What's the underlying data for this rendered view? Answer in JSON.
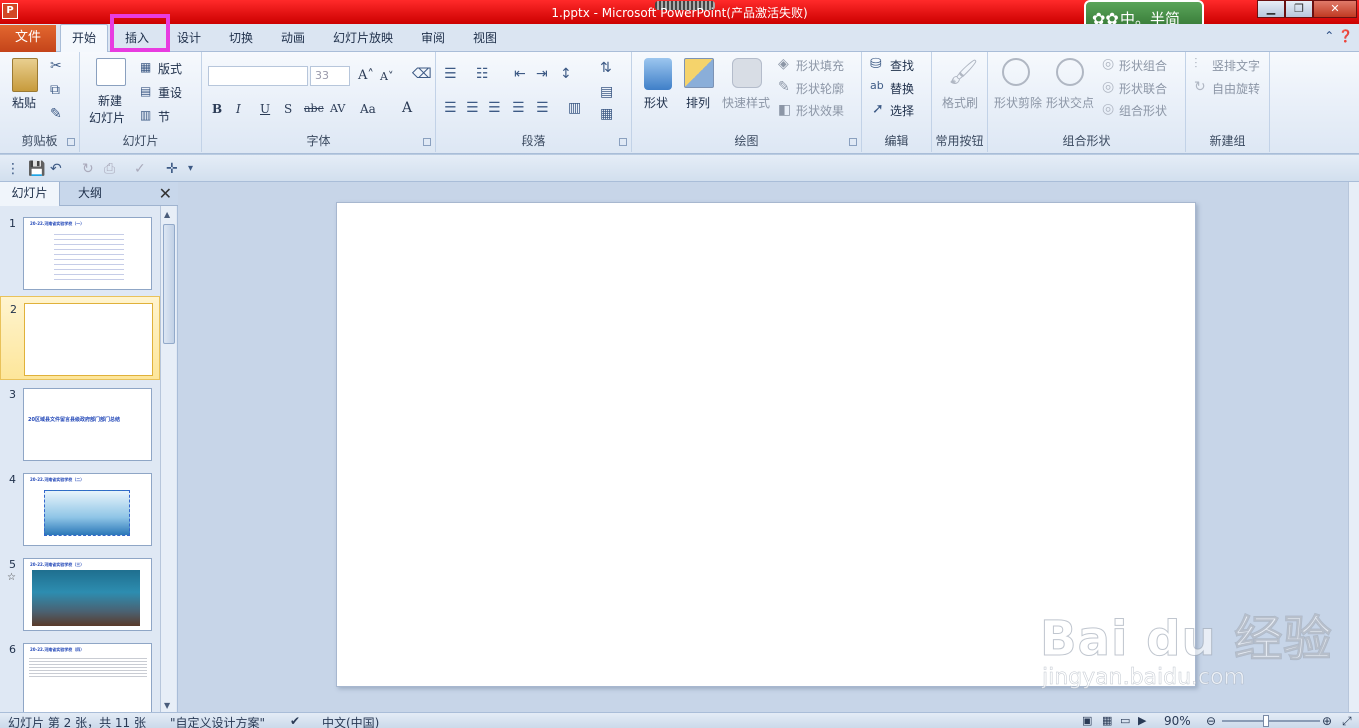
{
  "window": {
    "title": "1.pptx - Microsoft PowerPoint(产品激活失败)",
    "ime_text": "中。半简"
  },
  "tabs": {
    "file": "文件",
    "home": "开始",
    "insert": "插入",
    "design": "设计",
    "transitions": "切换",
    "animations": "动画",
    "slideshow": "幻灯片放映",
    "review": "审阅",
    "view": "视图"
  },
  "ribbon": {
    "clipboard": {
      "paste": "粘贴",
      "label": "剪贴板"
    },
    "slides": {
      "new_slide_line1": "新建",
      "new_slide_line2": "幻灯片",
      "layout": "版式",
      "reset": "重设",
      "section": "节",
      "label": "幻灯片"
    },
    "font": {
      "size_value": "33",
      "bold": "B",
      "italic": "I",
      "underline": "U",
      "shadow": "S",
      "strike": "abc",
      "spacing": "AV",
      "case": "Aa",
      "color": "A",
      "label": "字体"
    },
    "paragraph": {
      "label": "段落"
    },
    "drawing": {
      "shapes": "形状",
      "arrange": "排列",
      "quick_styles": "快速样式",
      "shape_fill": "形状填充",
      "shape_outline": "形状轮廓",
      "shape_effects": "形状效果",
      "label": "绘图"
    },
    "editing": {
      "find": "查找",
      "replace": "替换",
      "select": "选择",
      "label": "编辑"
    },
    "common": {
      "format_painter": "格式刷",
      "label": "常用按钮"
    },
    "combine": {
      "shape_subtract": "形状剪除",
      "shape_intersect": "形状交点",
      "shape_combine": "形状组合",
      "shape_union": "形状联合",
      "combine_shapes": "组合形状",
      "label": "组合形状"
    },
    "newgroup": {
      "vertical_text": "竖排文字",
      "free_rotate": "自由旋转",
      "label": "新建组"
    }
  },
  "pane": {
    "tab_slides": "幻灯片",
    "tab_outline": "大纲",
    "slides": [
      {
        "num": "1",
        "title": "20-22.河南省实验学校（一）",
        "selected": false
      },
      {
        "num": "2",
        "title": "",
        "selected": true
      },
      {
        "num": "3",
        "title": "20区域县文件留言县级政府部门部门总结",
        "selected": false
      },
      {
        "num": "4",
        "title": "20-22.河南省实验学校（二）",
        "selected": false
      },
      {
        "num": "5",
        "title": "20-22.河南省实验学校（三）",
        "selected": false
      },
      {
        "num": "6",
        "title": "20-22.河南省实验学校（四）",
        "selected": false
      }
    ]
  },
  "status": {
    "slide_info": "幻灯片 第 2 张，共 11 张",
    "theme": "\"自定义设计方案\"",
    "language": "中文(中国)",
    "zoom": "90%"
  },
  "watermark": {
    "main": "Bai du 经验",
    "sub": "jingyan.baidu.com"
  },
  "colors": {
    "title_bar": "#dd0000",
    "file_tab": "#d4582a",
    "highlight": "#e83ce0",
    "ribbon_bg": "#e4ecf7"
  }
}
